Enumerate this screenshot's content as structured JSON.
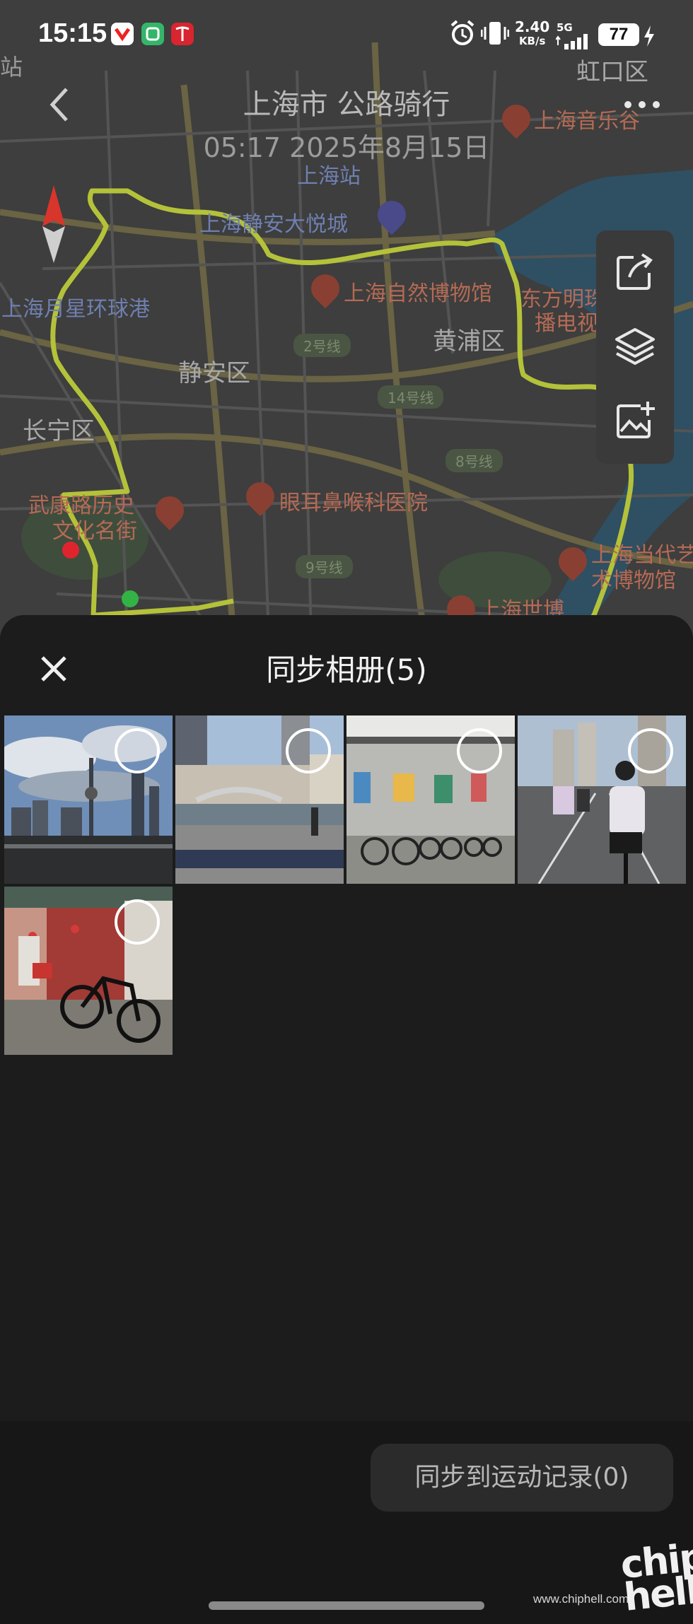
{
  "status_bar": {
    "time": "15:15",
    "net_speed_value": "2.40",
    "net_speed_unit": "KB/s",
    "signal_label": "5G",
    "battery": "77"
  },
  "header": {
    "title": "上海市 公路骑行",
    "subtitle": "05:17 2025年8月15日"
  },
  "map": {
    "labels": {
      "zhan": "站",
      "hongkou": "虹口区",
      "music_hall": "上海音乐谷",
      "shanghai_station": "上海站",
      "jingan_joy_city": "上海静安大悦城",
      "natural_museum": "上海自然博物馆",
      "oriental_pearl_1": "东方明珠广",
      "oriental_pearl_2": "播电视塔",
      "moonstar_port": "上海月星环球港",
      "huangpu": "黄浦区",
      "jingan": "静安区",
      "changning": "长宁区",
      "wukang_1": "武康路历史",
      "wukang_2": "文化名街",
      "eent_hospital": "眼耳鼻喉科医院",
      "contemporary_art_1": "上海当代艺",
      "contemporary_art_2": "术博物馆",
      "world_expo": "上海世博",
      "line_2": "2号线",
      "line_14": "14号线",
      "line_8": "8号线",
      "line_9": "9号线"
    },
    "route_color": "#b4c23a"
  },
  "sheet": {
    "title": "同步相册(5)",
    "photos": [
      {
        "subject": "Lujiazui skyline with Oriental Pearl Tower",
        "selected": false
      },
      {
        "subject": "Waibaidu bridge and cyclist on riverside",
        "selected": false
      },
      {
        "subject": "Bicycles parked along wall with posters",
        "selected": false
      },
      {
        "subject": "Cyclists riding on road",
        "selected": false
      },
      {
        "subject": "Road bike by temple gate with stone lions",
        "selected": false
      }
    ],
    "sync_button": "同步到运动记录(0)"
  },
  "watermark": {
    "logo": "chip hell",
    "url": "www.chiphell.com"
  },
  "colors": {
    "sheet_bg": "#1c1c1c",
    "footer_bg": "#171717",
    "button_bg": "#2b2b2b",
    "route": "#b4c23a"
  }
}
